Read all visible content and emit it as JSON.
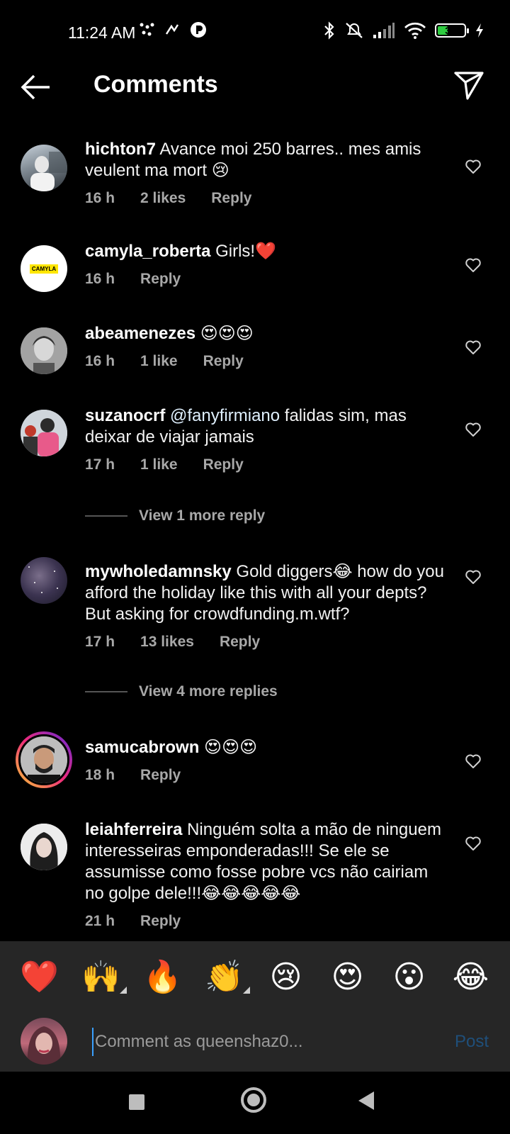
{
  "status_bar": {
    "time": "11:24 AM",
    "battery": "35",
    "icons": [
      "dots-icon",
      "speed-icon",
      "app-icon",
      "bluetooth-icon",
      "mute-icon",
      "signal-icon",
      "wifi-icon",
      "battery-icon",
      "charging-icon"
    ]
  },
  "header": {
    "title": "Comments"
  },
  "comments": [
    {
      "username": "hichton7",
      "text": " Avance moi 250 barres.. mes amis veulent ma mort 😢",
      "time": "16 h",
      "likes": "2 likes",
      "reply": "Reply"
    },
    {
      "username": "camyla_roberta",
      "text": " Girls!❤️",
      "time": "16 h",
      "likes": "",
      "reply": "Reply",
      "avatar_text": "CAMYLA"
    },
    {
      "username": "abeamenezes",
      "text": " 😍😍😍",
      "time": "16 h",
      "likes": "1 like",
      "reply": "Reply"
    },
    {
      "username": "suzanocrf",
      "mention": " @fanyfirmiano",
      "text": " falidas sim, mas deixar de viajar jamais",
      "time": "17 h",
      "likes": "1 like",
      "reply": "Reply",
      "more_replies": "View 1 more reply"
    },
    {
      "username": "mywholedamnsky",
      "text": " Gold diggers😂 how do you afford the holiday like this with all your depts? But asking for crowdfunding.m.wtf?",
      "time": "17 h",
      "likes": "13 likes",
      "reply": "Reply",
      "more_replies": "View 4 more replies"
    },
    {
      "username": "samucabrown",
      "text": " 😍😍😍",
      "time": "18 h",
      "likes": "",
      "reply": "Reply"
    },
    {
      "username": "leiahferreira",
      "text": " Ninguém solta a mão de ninguem interesseiras emponderadas!!! Se ele se assumisse como  fosse pobre vcs não cairiam no golpe dele!!!😂😂😂😂😂",
      "time": "21 h",
      "likes": "",
      "reply": "Reply"
    }
  ],
  "emoji_bar": [
    "❤️",
    "🙌",
    "🔥",
    "👏",
    "😢",
    "😍",
    "😮",
    "😂"
  ],
  "input": {
    "placeholder": "Comment as queenshaz0...",
    "post_label": "Post"
  }
}
